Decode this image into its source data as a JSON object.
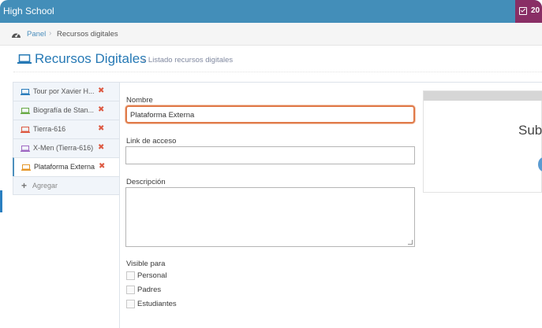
{
  "navbar": {
    "brand": "High School",
    "right_text": "20",
    "right_icon": "calendar-check-icon",
    "bg": "#438eb9",
    "accent": "#892e65"
  },
  "breadcrumb": {
    "icon": "dashboard-icon",
    "home": "Panel",
    "separator": "›",
    "current": "Recursos digitales"
  },
  "header": {
    "icon": "laptop-icon",
    "title": "Recursos Digitales",
    "subtitle": "» Listado recursos digitales"
  },
  "tabs": [
    {
      "label": "Tour por Xavier H...",
      "icon_color": "#2b7dbc",
      "remove": "✖"
    },
    {
      "label": "Biografía de Stan...",
      "icon_color": "#69aa46",
      "remove": "✖"
    },
    {
      "label": "Tierra-616",
      "icon_color": "#dd5a43",
      "remove": "✖"
    },
    {
      "label": "X-Men (Tierra-616)",
      "icon_color": "#a069c3",
      "remove": "✖"
    },
    {
      "label": "Plataforma Externa",
      "icon_color": "#e59729",
      "remove": "✖"
    }
  ],
  "add_tab": {
    "label": "Agregar",
    "icon": "plus-icon"
  },
  "form": {
    "nombre_label": "Nombre",
    "nombre_value": "Plataforma Externa",
    "link_label": "Link de acceso",
    "link_value": "",
    "descripcion_label": "Descripción",
    "visible_label": "Visible para",
    "visible_options": [
      "Personal",
      "Padres",
      "Estudiantes"
    ]
  },
  "upload": {
    "text": "Sub"
  }
}
